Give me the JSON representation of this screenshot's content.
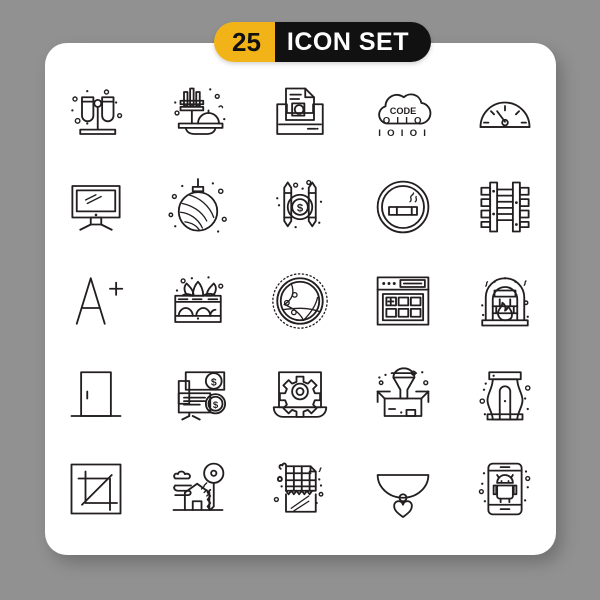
{
  "page": {
    "background_color": "#919191",
    "card_color": "#ffffff"
  },
  "header": {
    "count": "25",
    "title": "ICON SET",
    "count_bg": "#F2B319",
    "count_fg": "#111111",
    "title_bg": "#111111",
    "title_fg": "#ffffff"
  },
  "grid": {
    "columns": 5,
    "rows": 5,
    "stroke_color": "#231f20",
    "icons": [
      {
        "name": "test-tubes-stand-icon",
        "label": "Test Tubes Stand"
      },
      {
        "name": "food-dish-cloche-icon",
        "label": "Food Dish"
      },
      {
        "name": "document-folder-icon",
        "label": "Document Folder"
      },
      {
        "name": "cloud-code-icon",
        "label": "Cloud Code",
        "text": {
          "word": "CODE",
          "line1": "O I I O",
          "line2": "I O I O I"
        }
      },
      {
        "name": "speedometer-gauge-icon",
        "label": "Speedometer"
      },
      {
        "name": "computer-monitor-icon",
        "label": "Computer Monitor"
      },
      {
        "name": "christmas-bauble-icon",
        "label": "Christmas Bauble"
      },
      {
        "name": "money-pencils-coin-icon",
        "label": "Money Pencils Coin",
        "text": {
          "symbol": "$"
        }
      },
      {
        "name": "smoking-area-icon",
        "label": "Smoking Area"
      },
      {
        "name": "railway-track-icon",
        "label": "Railway Track"
      },
      {
        "name": "a-plus-grade-icon",
        "label": "A Plus Grade",
        "text": {
          "letter": "A",
          "plus": "+"
        }
      },
      {
        "name": "flower-planter-box-icon",
        "label": "Flower Planter Box"
      },
      {
        "name": "globe-network-icon",
        "label": "Globe Network"
      },
      {
        "name": "browser-app-grid-icon",
        "label": "Browser App Grid",
        "text": {
          "plus": "+"
        }
      },
      {
        "name": "fireplace-icon",
        "label": "Fireplace"
      },
      {
        "name": "door-icon",
        "label": "Door"
      },
      {
        "name": "online-money-monitor-icon",
        "label": "Online Money Monitor",
        "text": {
          "symbol1": "$",
          "symbol2": "$"
        }
      },
      {
        "name": "laptop-settings-gear-icon",
        "label": "Laptop Settings"
      },
      {
        "name": "funnel-box-icon",
        "label": "Funnel Box"
      },
      {
        "name": "pencil-sharpener-icon",
        "label": "Pencil Sharpener"
      },
      {
        "name": "crop-tool-icon",
        "label": "Crop Tool"
      },
      {
        "name": "house-key-icon",
        "label": "House Key"
      },
      {
        "name": "chocolate-bar-icon",
        "label": "Chocolate Bar"
      },
      {
        "name": "heart-necklace-icon",
        "label": "Heart Necklace"
      },
      {
        "name": "android-smartphone-icon",
        "label": "Android Smartphone"
      }
    ]
  }
}
